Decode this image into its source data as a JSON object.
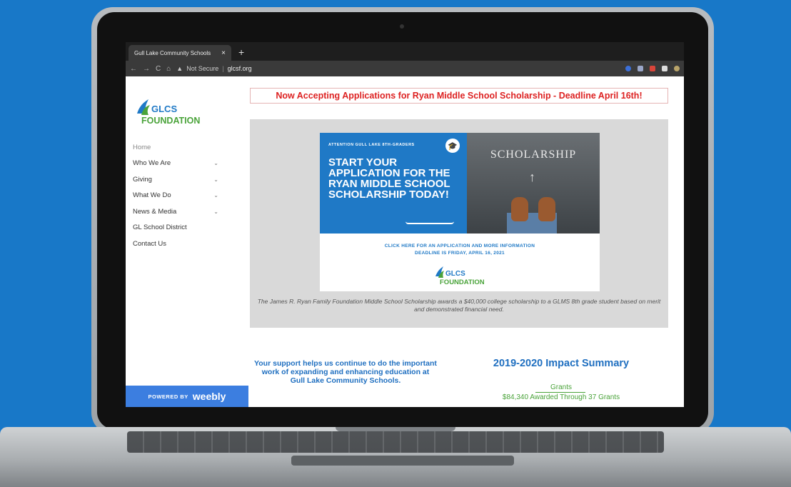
{
  "browser": {
    "tab_title": "Gull Lake Community Schools",
    "tab_close": "×",
    "new_tab": "+",
    "nav_back": "←",
    "nav_forward": "→",
    "nav_reload": "C",
    "nav_home": "⌂",
    "warning": "▲",
    "not_secure": "Not Secure",
    "separator": "|",
    "url": "glcsf.org"
  },
  "sidebar": {
    "logo_top": "GLCS",
    "logo_bottom": "FOUNDATION",
    "items": [
      {
        "label": "Home",
        "chevron": ""
      },
      {
        "label": "Who We Are",
        "chevron": "⌄"
      },
      {
        "label": "Giving",
        "chevron": "⌄"
      },
      {
        "label": "What We Do",
        "chevron": "⌄"
      },
      {
        "label": "News & Media",
        "chevron": "⌄"
      },
      {
        "label": "GL School District",
        "chevron": ""
      },
      {
        "label": "Contact Us",
        "chevron": ""
      }
    ],
    "powered_by": "POWERED BY",
    "weebly": "weebly"
  },
  "main": {
    "banner": "Now Accepting Applications for Ryan Middle School Scholarship - Deadline April 16th!",
    "promo": {
      "kicker": "ATTENTION GULL LAKE 8TH-GRADERS",
      "headline": "START YOUR APPLICATION FOR THE RYAN MIDDLE SCHOOL SCHOLARSHIP TODAY!",
      "right_word": "SCHOLARSHIP",
      "cta": "CLICK HERE FOR AN APPLICATION AND MORE INFORMATION",
      "deadline": "DEADLINE IS FRIDAY, APRIL 16, 2021",
      "logo_top": "GLCS",
      "logo_bottom": "FOUNDATION"
    },
    "caption": "The James R. Ryan Family Foundation Middle School Scholarship awards a $40,000 college scholarship to a GLMS 8th grade student based on merit and demonstrated financial need.",
    "support": "Your support helps us continue to do the important work of expanding and enhancing education at Gull Lake Community Schools.",
    "impact_title": "2019-2020 Impact Summary",
    "grants_label": "Grants",
    "grants_value": "$84,340 Awarded Through 37 Grants"
  },
  "colors": {
    "background": "#1878c8",
    "brand_blue": "#1f79c6",
    "banner_red": "#d22222",
    "green": "#4aa33a"
  }
}
